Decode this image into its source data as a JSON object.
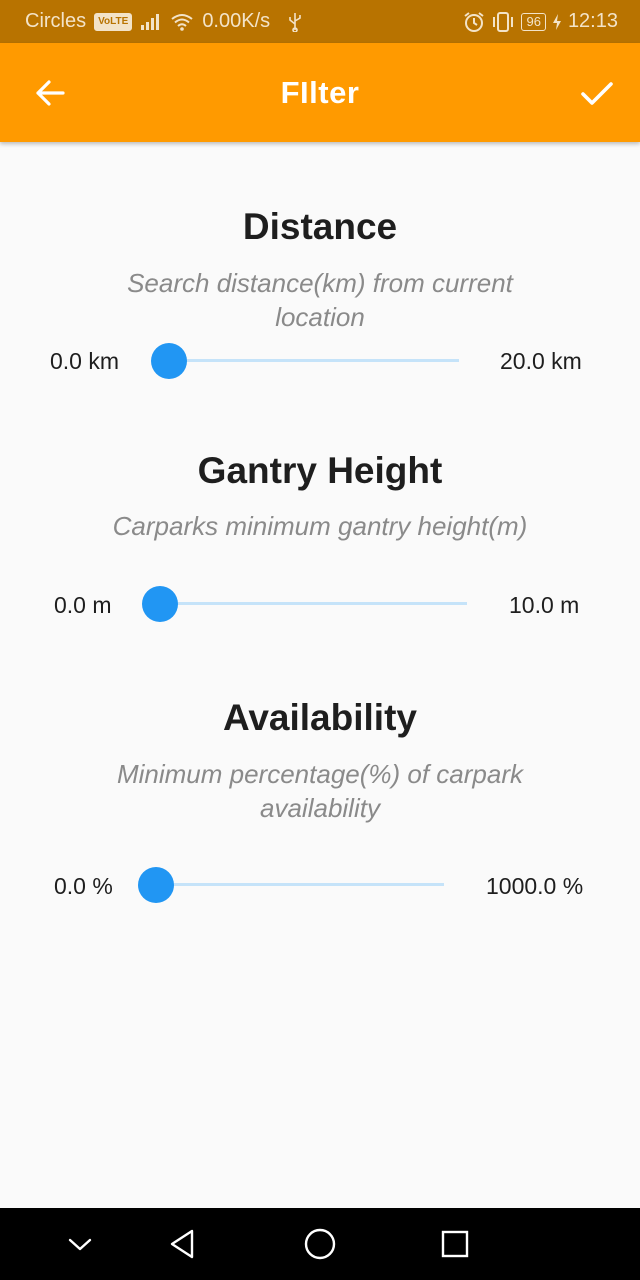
{
  "status_bar": {
    "carrier": "Circles",
    "volte_badge": "VoLTE",
    "network_speed": "0.00K/s",
    "battery": "96",
    "time": "12:13",
    "icons": [
      "signal-icon",
      "wifi-icon",
      "usb-icon",
      "alarm-icon",
      "vibrate-icon",
      "battery-icon",
      "charging-icon"
    ]
  },
  "app_bar": {
    "title": "FIlter",
    "back_icon": "arrow-left-icon",
    "confirm_icon": "check-icon",
    "background": "#ff9a00"
  },
  "sections": {
    "distance": {
      "title": "Distance",
      "subtitle": "Search distance(km) from current location",
      "min_label": "0.0 km",
      "max_label": "20.0 km",
      "value_fraction": 0
    },
    "gantry": {
      "title": "Gantry Height",
      "subtitle": "Carparks minimum gantry height(m)",
      "min_label": "0.0 m",
      "max_label": "10.0 m",
      "value_fraction": 0
    },
    "availability": {
      "title": "Availability",
      "subtitle_line1": "Minimum percentage(%) of carpark",
      "subtitle_line2": "availability",
      "min_label": "0.0 %",
      "max_label": "1000.0 %",
      "value_fraction": 0
    }
  },
  "slider_colors": {
    "thumb": "#2196f3",
    "track": "#c5e3f9"
  },
  "nav_bar": {
    "buttons": [
      "chevron-down-icon",
      "back-triangle-icon",
      "home-circle-icon",
      "recents-square-icon"
    ]
  }
}
